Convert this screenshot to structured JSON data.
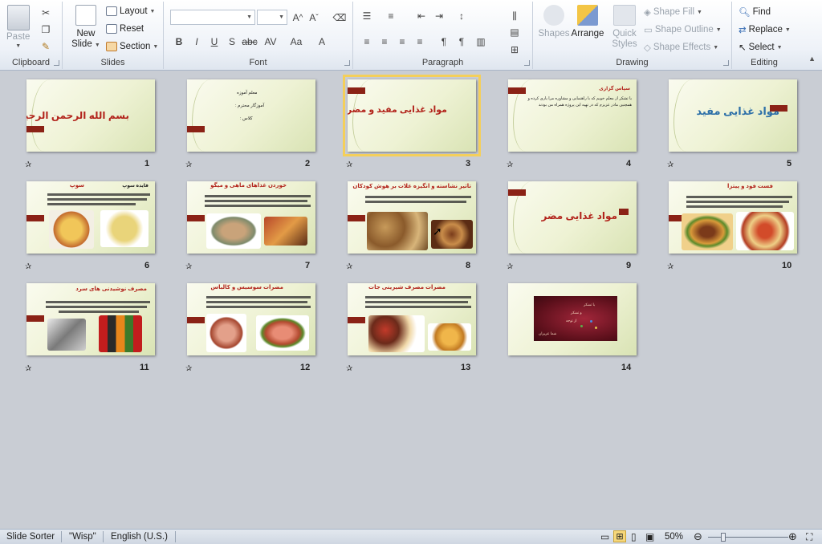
{
  "ribbon": {
    "clipboard": {
      "label": "Clipboard",
      "paste": "Paste"
    },
    "slides": {
      "label": "Slides",
      "new_slide_line1": "New",
      "new_slide_line2": "Slide",
      "layout": "Layout",
      "reset": "Reset",
      "section": "Section"
    },
    "font": {
      "label": "Font",
      "font_name": "",
      "font_size": ""
    },
    "paragraph": {
      "label": "Paragraph"
    },
    "drawing": {
      "label": "Drawing",
      "shapes": "Shapes",
      "arrange": "Arrange",
      "quick_styles_line1": "Quick",
      "quick_styles_line2": "Styles",
      "shape_fill": "Shape Fill",
      "shape_outline": "Shape Outline",
      "shape_effects": "Shape Effects"
    },
    "editing": {
      "label": "Editing",
      "find": "Find",
      "replace": "Replace",
      "select": "Select"
    }
  },
  "slides": [
    {
      "number": "1",
      "title": "بسم الله الرحمن الرحيم",
      "title_color": "#b2231b"
    },
    {
      "number": "2",
      "lines": [
        "معلم آموزه",
        "آموزگار محترم :",
        "کلاس :"
      ]
    },
    {
      "number": "3",
      "title": "مواد غذایی مفید و مضر",
      "title_color": "#b2231b"
    },
    {
      "number": "4",
      "title": "سپاس گزاری",
      "title_color": "#b2231b",
      "body": "با تشکر از معلم خوبم که با راهنمایی و مشاوره مرا یاری کرده و همچنین مادر عزیزم که در تهیه این پروژه همراه من بودند"
    },
    {
      "number": "5",
      "title": "مواد غذایی مفید",
      "title_color": "#2c6fa8"
    },
    {
      "number": "6",
      "title": "سوپ",
      "title_color": "#b2231b",
      "subtitle": "فایده سوپ"
    },
    {
      "number": "7",
      "title": "خوردن غذاهای ماهی و میگو",
      "title_color": "#b2231b"
    },
    {
      "number": "8",
      "title": "تاثیر نشاسته و انگیزه غلات بر هوش کودکان",
      "title_color": "#b2231b"
    },
    {
      "number": "9",
      "title": "مواد غذایی مضر",
      "title_color": "#b2231b"
    },
    {
      "number": "10",
      "title": "فست فود و پیتزا",
      "title_color": "#b2231b"
    },
    {
      "number": "11",
      "title": "مصرف نوشیدنی های سرد",
      "title_color": "#b2231b"
    },
    {
      "number": "12",
      "title": "مضرات سوسیس و کالباس",
      "title_color": "#b2231b"
    },
    {
      "number": "13",
      "title": "مضرات مصرف شیرینی جات",
      "title_color": "#b2231b"
    },
    {
      "number": "14",
      "lines": [
        "با تشکر",
        "و تشکر",
        "از توجه",
        "شما عزیزان"
      ]
    }
  ],
  "status": {
    "view": "Slide Sorter",
    "theme": "\"Wisp\"",
    "language": "English (U.S.)",
    "zoom": "50%"
  },
  "colors": {
    "accent_flag": "#8b2216",
    "selection": "#f4cf5a",
    "slide_bg": "#eef2d4"
  }
}
